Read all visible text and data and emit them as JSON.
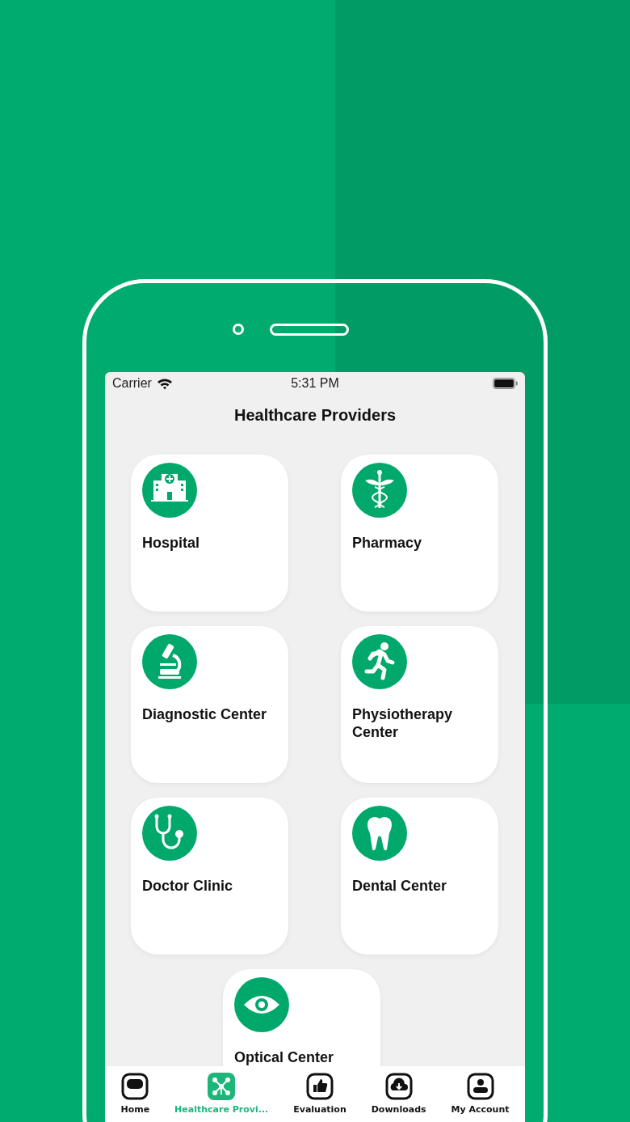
{
  "status_bar": {
    "carrier": "Carrier",
    "time": "5:31 PM"
  },
  "title": "Healthcare Providers",
  "providers": [
    {
      "label": "Hospital",
      "kind": "hospital"
    },
    {
      "label": "Pharmacy",
      "kind": "pharmacy"
    },
    {
      "label": "Diagnostic Center",
      "kind": "microscope"
    },
    {
      "label": "Physiotherapy Center",
      "kind": "runner"
    },
    {
      "label": "Doctor Clinic",
      "kind": "stethoscope"
    },
    {
      "label": "Dental Center",
      "kind": "tooth"
    },
    {
      "label": "Optical Center",
      "kind": "eye"
    }
  ],
  "tab_bar": [
    {
      "label": "Home",
      "kind": "home",
      "selected": false
    },
    {
      "label": "Healthcare Provi...",
      "kind": "network",
      "selected": true
    },
    {
      "label": "Evaluation",
      "kind": "thumb",
      "selected": false
    },
    {
      "label": "Downloads",
      "kind": "download",
      "selected": false
    },
    {
      "label": "My Account",
      "kind": "account",
      "selected": false
    }
  ]
}
